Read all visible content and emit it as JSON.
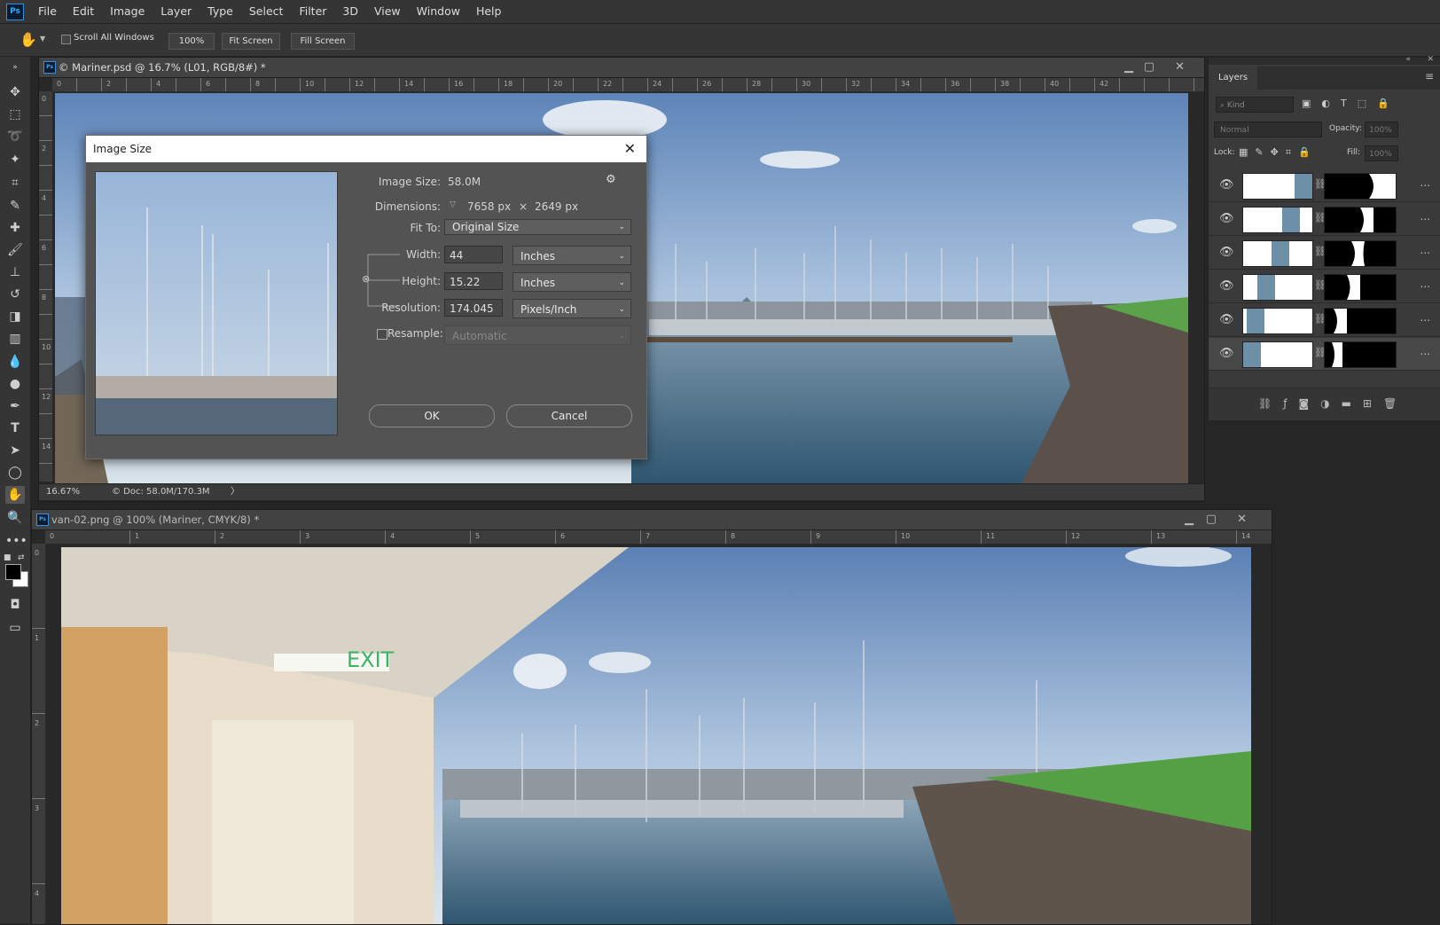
{
  "app": {
    "logo": "Ps",
    "menu": [
      "File",
      "Edit",
      "Image",
      "Layer",
      "Type",
      "Select",
      "Filter",
      "3D",
      "View",
      "Window",
      "Help"
    ]
  },
  "options": {
    "scroll_all_windows": "Scroll All Windows",
    "zoom_level": "100%",
    "fit_screen": "Fit Screen",
    "fill_screen": "Fill Screen"
  },
  "doc1": {
    "title": "© Mariner.psd @ 16.7% (L01, RGB/8#) *",
    "ruler_h": [
      "0",
      "2",
      "4",
      "6",
      "8",
      "10",
      "12",
      "14",
      "16",
      "18",
      "20",
      "22",
      "24",
      "26",
      "28",
      "30",
      "32",
      "34",
      "36",
      "38",
      "40",
      "42"
    ],
    "ruler_v": [
      "0",
      "2",
      "4",
      "6",
      "8",
      "10",
      "12",
      "14"
    ],
    "zoom": "16.67%",
    "doc_info": "© Doc: 58.0M/170.3M"
  },
  "doc2": {
    "title": "van-02.png @ 100% (Mariner, CMYK/8) *",
    "ruler_h": [
      "0",
      "1",
      "2",
      "3",
      "4",
      "5",
      "6",
      "7",
      "8",
      "9",
      "10",
      "11",
      "12",
      "13",
      "14"
    ],
    "ruler_v": [
      "0",
      "1",
      "2",
      "3",
      "4"
    ],
    "exit_sign": "EXIT"
  },
  "dialog": {
    "title": "Image Size",
    "image_size_label": "Image Size:",
    "image_size_value": "58.0M",
    "dimensions_label": "Dimensions:",
    "dim_width": "7658 px",
    "dim_x": "×",
    "dim_height": "2649 px",
    "fit_to_label": "Fit To:",
    "fit_to_value": "Original Size",
    "width_label": "Width:",
    "width_value": "44",
    "width_unit": "Inches",
    "height_label": "Height:",
    "height_value": "15.22",
    "height_unit": "Inches",
    "resolution_label": "Resolution:",
    "resolution_value": "174.045",
    "resolution_unit": "Pixels/Inch",
    "resample_label": "Resample:",
    "resample_value": "Automatic",
    "ok": "OK",
    "cancel": "Cancel"
  },
  "layers_panel": {
    "tab": "Layers",
    "kind_placeholder": "Kind",
    "blend_mode": "Normal",
    "opacity_label": "Opacity:",
    "opacity_value": "100%",
    "lock_label": "Lock:",
    "fill_label": "Fill:",
    "fill_value": "100%",
    "layer_count_dots": "..."
  },
  "colors": {
    "accent": "#31a8ff",
    "dialog_bg": "#535353",
    "panel_bg": "#3a3a3a"
  }
}
